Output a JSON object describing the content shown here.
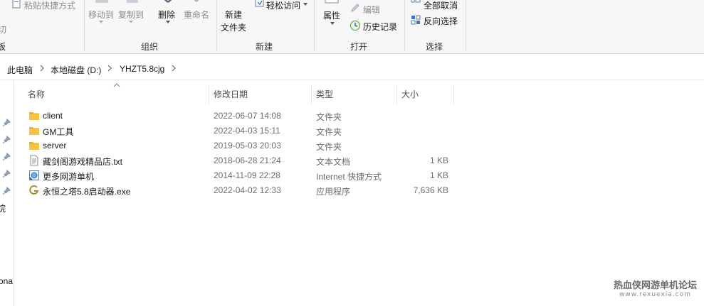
{
  "ribbon": {
    "clipboard": {
      "paste_shortcut": "粘贴快捷方式",
      "cut_partial": "切",
      "group_partial": "板"
    },
    "organize": {
      "move_to": "移动到",
      "copy_to": "复制到",
      "delete": "删除",
      "rename": "重命名",
      "group_label": "组织"
    },
    "new": {
      "new_folder_line1": "新建",
      "new_folder_line2": "文件夹",
      "easy_access": "轻松访问",
      "group_label": "新建"
    },
    "open": {
      "properties": "属性",
      "edit": "编辑",
      "history": "历史记录",
      "group_label": "打开"
    },
    "select": {
      "select_none": "全部取消",
      "invert_selection": "反向选择",
      "group_label": "选择"
    }
  },
  "address": {
    "crumbs": [
      "此电脑",
      "本地磁盘 (D:)",
      "YHZT5.8cjg"
    ]
  },
  "nav": {
    "partial_item_1": "烷",
    "partial_item_2": "ona"
  },
  "columns": {
    "name": "名称",
    "date": "修改日期",
    "type": "类型",
    "size": "大小"
  },
  "files": [
    {
      "name": "client",
      "date": "2022-06-07 14:08",
      "type": "文件夹",
      "size": "",
      "icon": "folder-icon"
    },
    {
      "name": "GM工具",
      "date": "2022-04-03 15:11",
      "type": "文件夹",
      "size": "",
      "icon": "folder-icon"
    },
    {
      "name": "server",
      "date": "2019-05-03 20:03",
      "type": "文件夹",
      "size": "",
      "icon": "folder-icon"
    },
    {
      "name": "藏剑阁游戏精品店.txt",
      "date": "2018-06-28 21:24",
      "type": "文本文档",
      "size": "1 KB",
      "icon": "text-file-icon"
    },
    {
      "name": "更多网游单机",
      "date": "2014-11-09 22:28",
      "type": "Internet 快捷方式",
      "size": "1 KB",
      "icon": "internet-shortcut-icon"
    },
    {
      "name": "永恒之塔5.8启动器.exe",
      "date": "2022-04-02 12:33",
      "type": "应用程序",
      "size": "7,636 KB",
      "icon": "app-exe-icon"
    }
  ],
  "watermark": {
    "title": "热血侠网游单机论坛",
    "url": "www.rexuexia.com"
  },
  "colors": {
    "folder": "#f6c445",
    "ribbon_bg": "#f7f7f7",
    "accent": "#0078d7"
  }
}
